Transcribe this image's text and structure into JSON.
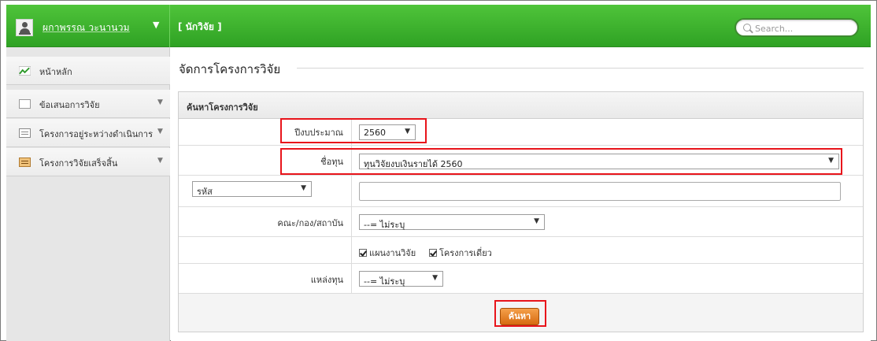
{
  "header": {
    "user_name": "ผกาพรรณ วะนานวม",
    "user_caret": "▼",
    "role": "[ นักวิจัย ]",
    "search_placeholder": "Search..."
  },
  "sidebar": {
    "items": [
      {
        "label": "หน้าหลัก",
        "icon": "chart-icon",
        "caret": ""
      },
      {
        "label": "ข้อเสนอการวิจัย",
        "icon": "document-icon",
        "caret": "▼"
      },
      {
        "label": "โครงการอยู่ระหว่างดำเนินการ",
        "icon": "list-icon",
        "caret": "▼"
      },
      {
        "label": "โครงการวิจัยเสร็จสิ้น",
        "icon": "folder-icon",
        "caret": "▼"
      }
    ]
  },
  "main": {
    "page_title": "จัดการโครงการวิจัย",
    "panel_title": "ค้นหาโครงการวิจัย",
    "form": {
      "year_label": "ปีงบประมาณ",
      "year_value": "2560",
      "fund_label": "ชื่อทุน",
      "fund_value": "ทุนวิจัยงบเงินรายได้ 2560",
      "code_select": "รหัส",
      "code_value": "",
      "faculty_label": "คณะ/กอง/สถาบัน",
      "faculty_value": "--= ไม่ระบุ",
      "check_plan": "แผนงานวิจัย",
      "check_single": "โครงการเดี่ยว",
      "source_label": "แหล่งทุน",
      "source_value": "--= ไม่ระบุ",
      "caret": "▼"
    },
    "search_button": "ค้นหา"
  },
  "colors": {
    "header_green": "#3cb52e",
    "highlight_red": "#e8141b",
    "button_orange": "#e07d20"
  }
}
